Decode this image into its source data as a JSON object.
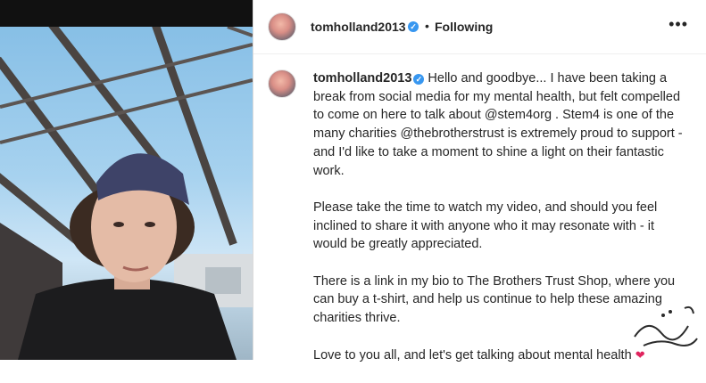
{
  "post": {
    "username": "tomholland2013",
    "dot": "•",
    "follow_status": "Following",
    "more_icon": "more-options-icon",
    "verified_icon": "verified-badge-icon"
  },
  "caption": {
    "username": "tomholland2013",
    "p1": "Hello and goodbye... I have been taking a break from social media for my mental health, but felt compelled to come on here to talk about @stem4org . Stem4 is one of the many charities @thebrotherstrust is extremely proud to support - and I'd like to take a moment to shine a light on their fantastic work.",
    "p2": "Please take the time to watch my video, and should you feel inclined to share it with anyone who it may resonate with - it would be greatly appreciated.",
    "p3": "There is a link in my bio to The Brothers Trust Shop, where you can buy a t-shirt, and help us continue to help these amazing charities thrive.",
    "p4": "Love to you all, and let's get talking about mental health",
    "emoji": "❤"
  },
  "colors": {
    "verified": "#3897f0",
    "text": "#262626",
    "divider": "#dbdbdb"
  }
}
